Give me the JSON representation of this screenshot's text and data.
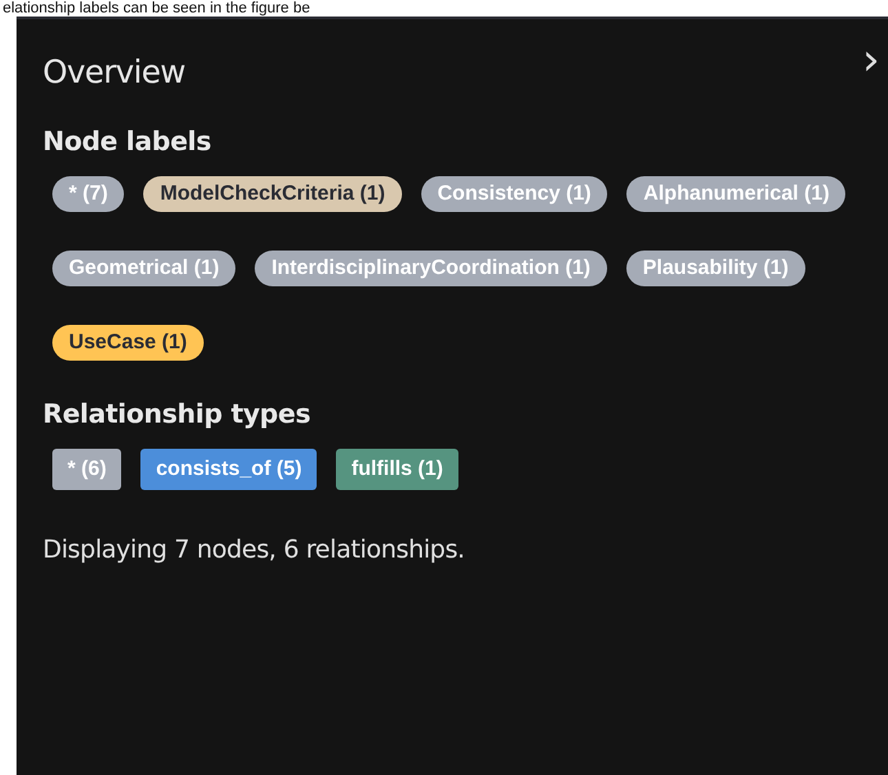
{
  "caption": "elationship labels can be seen in the figure be",
  "panel": {
    "title": "Overview",
    "collapse_icon": "›"
  },
  "node_labels": {
    "heading": "Node labels",
    "items": [
      {
        "label": "* (7)",
        "color": "#a5abb6"
      },
      {
        "label": "ModelCheckCriteria (1)",
        "color": "#d9c8ae"
      },
      {
        "label": "Consistency (1)",
        "color": "#a5abb6"
      },
      {
        "label": "Alphanumerical (1)",
        "color": "#a5abb6"
      },
      {
        "label": "Geometrical (1)",
        "color": "#a5abb6"
      },
      {
        "label": "InterdisciplinaryCoordination (1)",
        "color": "#a5abb6"
      },
      {
        "label": "Plausability (1)",
        "color": "#a5abb6"
      },
      {
        "label": "UseCase (1)",
        "color": "#ffc454"
      }
    ]
  },
  "relationship_types": {
    "heading": "Relationship types",
    "items": [
      {
        "label": "* (6)",
        "color": "#a5abb6"
      },
      {
        "label": "consists_of (5)",
        "color": "#4c8eda"
      },
      {
        "label": "fulfills (1)",
        "color": "#569480"
      }
    ]
  },
  "status": "Displaying 7 nodes, 6 relationships."
}
